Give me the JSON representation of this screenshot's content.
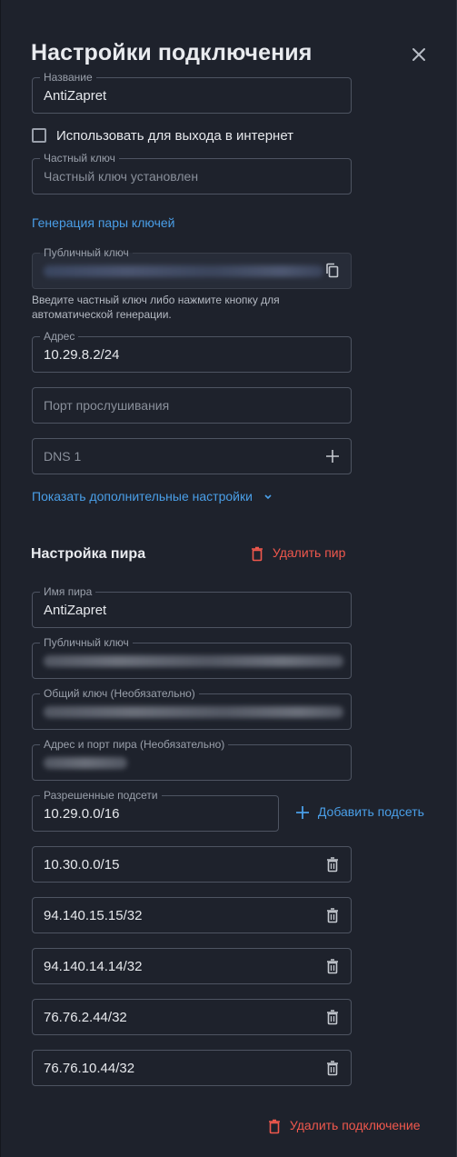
{
  "header": {
    "title": "Настройки подключения",
    "close_icon": "close-icon"
  },
  "connection": {
    "name": {
      "label": "Название",
      "value": "AntiZapret"
    },
    "use_for_internet": {
      "label": "Использовать для выхода в интернет",
      "checked": false
    },
    "private_key": {
      "label": "Частный ключ",
      "placeholder": "Частный ключ установлен"
    },
    "generate_keys_link": "Генерация пары ключей",
    "public_key": {
      "label": "Публичный ключ",
      "redacted": true,
      "copy_icon": "copy-icon"
    },
    "hint": "Введите частный ключ либо нажмите кнопку для автоматической генерации.",
    "address": {
      "label": "Адрес",
      "value": "10.29.8.2/24"
    },
    "listen_port": {
      "placeholder": "Порт прослушивания"
    },
    "dns": {
      "placeholder": "DNS 1",
      "add_icon": "plus-icon"
    },
    "advanced_link": "Показать дополнительные настройки"
  },
  "peer": {
    "section_title": "Настройка пира",
    "delete_peer_label": "Удалить пир",
    "name": {
      "label": "Имя пира",
      "value": "AntiZapret"
    },
    "public_key": {
      "label": "Публичный ключ",
      "redacted": true
    },
    "preshared_key": {
      "label": "Общий ключ (Необязательно)",
      "redacted": true
    },
    "endpoint": {
      "label": "Адрес и порт пира (Необязательно)",
      "redacted": true
    },
    "allowed_ips": {
      "label": "Разрешенные подсети",
      "first": "10.29.0.0/16",
      "add_label": "Добавить подсеть",
      "items": [
        "10.30.0.0/15",
        "94.140.15.15/32",
        "94.140.14.14/32",
        "76.76.2.44/32",
        "76.76.10.44/32"
      ]
    }
  },
  "footer": {
    "delete_connection_label": "Удалить подключение"
  },
  "colors": {
    "background": "#1e222c",
    "accent": "#4a9fe8",
    "danger": "#f0584d",
    "border": "#4e5462"
  }
}
